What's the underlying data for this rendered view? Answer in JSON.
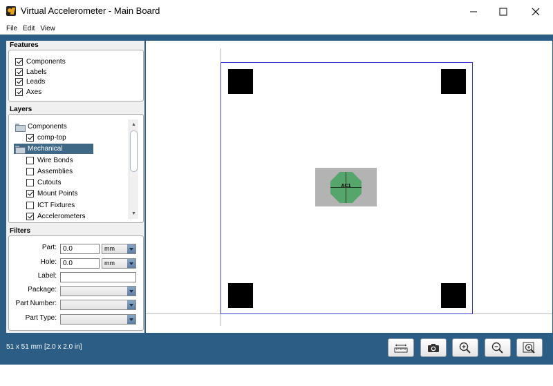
{
  "window": {
    "title": "Virtual Accelerometer - Main Board"
  },
  "menu": [
    {
      "label": "File"
    },
    {
      "label": "Edit"
    },
    {
      "label": "View"
    }
  ],
  "features": {
    "title": "Features",
    "items": [
      {
        "label": "Components",
        "checked": true
      },
      {
        "label": "Labels",
        "checked": true
      },
      {
        "label": "Leads",
        "checked": true
      },
      {
        "label": "Axes",
        "checked": true
      }
    ]
  },
  "layers": {
    "title": "Layers",
    "groups": [
      {
        "label": "Components",
        "selected": false
      },
      {
        "label": "Mechanical",
        "selected": true
      }
    ],
    "items": [
      {
        "label": "comp-top",
        "checked": true
      },
      {
        "label": "Wire Bonds",
        "checked": false
      },
      {
        "label": "Assemblies",
        "checked": false
      },
      {
        "label": "Cutouts",
        "checked": false
      },
      {
        "label": "Mount Points",
        "checked": true
      },
      {
        "label": "ICT Fixtures",
        "checked": false
      },
      {
        "label": "Accelerometers",
        "checked": true
      }
    ]
  },
  "filters": {
    "title": "Filters",
    "part_label": "Part:",
    "part_value": "0.0",
    "part_unit": "mm",
    "hole_label": "Hole:",
    "hole_value": "0.0",
    "hole_unit": "mm",
    "label_label": "Label:",
    "label_value": "",
    "package_label": "Package:",
    "package_value": "",
    "part_number_label": "Part Number:",
    "part_number_value": "",
    "part_type_label": "Part Type:",
    "part_type_value": ""
  },
  "board": {
    "component_label": "AC1"
  },
  "status": {
    "size_text": "51 x 51 mm  [2.0 x 2.0 in]"
  },
  "toolbar": {
    "buttons": [
      {
        "icon": "ruler-icon"
      },
      {
        "icon": "camera-icon"
      },
      {
        "icon": "zoom-in-icon"
      },
      {
        "icon": "zoom-out-icon"
      },
      {
        "icon": "zoom-fit-icon"
      }
    ]
  },
  "colors": {
    "frame": "#2b5d85",
    "board_outline": "#3a3ad0",
    "accelerometer": "#55a56c",
    "selection": "#3f6887"
  }
}
